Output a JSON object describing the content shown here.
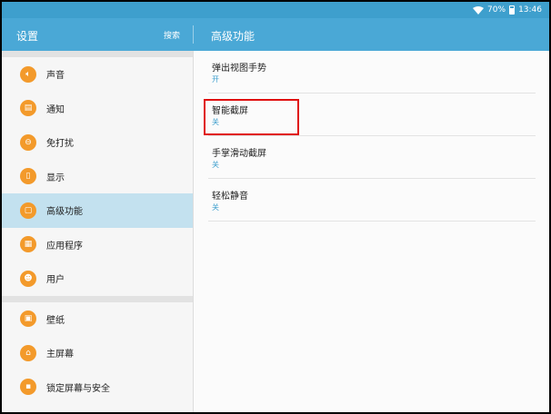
{
  "status_bar": {
    "battery": "70%",
    "time": "13:46"
  },
  "header": {
    "left_title": "设置",
    "search_label": "搜索",
    "right_title": "高级功能"
  },
  "sidebar": {
    "groups": [
      [
        {
          "label": "声音",
          "icon": "speaker-icon"
        },
        {
          "label": "通知",
          "icon": "notification-icon"
        },
        {
          "label": "免打扰",
          "icon": "do-not-disturb-icon"
        },
        {
          "label": "显示",
          "icon": "display-icon"
        },
        {
          "label": "高级功能",
          "icon": "advanced-features-icon",
          "active": true
        },
        {
          "label": "应用程序",
          "icon": "apps-grid-icon"
        },
        {
          "label": "用户",
          "icon": "users-icon"
        }
      ],
      [
        {
          "label": "壁纸",
          "icon": "wallpaper-icon"
        },
        {
          "label": "主屏幕",
          "icon": "home-icon"
        },
        {
          "label": "锁定屏幕与安全",
          "icon": "lock-icon"
        }
      ]
    ]
  },
  "settings": [
    {
      "title": "弹出视图手势",
      "value": "开"
    },
    {
      "title": "智能截屏",
      "value": "关"
    },
    {
      "title": "手掌滑动截屏",
      "value": "关"
    },
    {
      "title": "轻松静音",
      "value": "关"
    }
  ],
  "colors": {
    "accent": "#4aa8d6",
    "icon_bg": "#f39a2b",
    "active_bg": "#c3e1ef",
    "highlight": "#e01010"
  }
}
